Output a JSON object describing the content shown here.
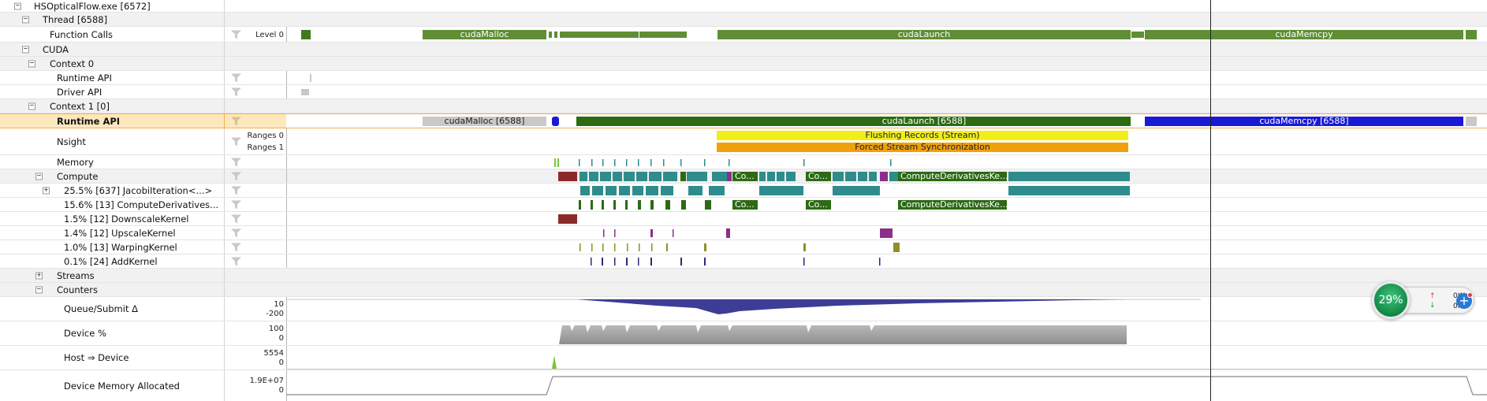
{
  "tree": {
    "process": "HSOpticalFlow.exe [6572]",
    "thread": "Thread [6588]",
    "function_calls": "Function Calls",
    "level_label": "Level 0",
    "cuda": "CUDA",
    "context0": "Context 0",
    "runtime_api_0": "Runtime API",
    "driver_api": "Driver API",
    "context1": "Context 1 [0]",
    "runtime_api_1": "Runtime API",
    "nsight": "Nsight",
    "ranges0": "Ranges 0",
    "ranges1": "Ranges 1",
    "memory": "Memory",
    "compute": "Compute",
    "kernels": [
      "25.5% [637] JacobiIteration<...>",
      "15.6% [13] ComputeDerivatives...",
      "1.5% [12] DownscaleKernel",
      "1.4% [12] UpscaleKernel",
      "1.0% [13] WarpingKernel",
      "0.1% [24] AddKernel"
    ],
    "streams": "Streams",
    "counters": "Counters",
    "counter_rows": [
      {
        "name": "Queue/Submit Δ",
        "max": "10",
        "min": "-200"
      },
      {
        "name": "Device %",
        "max": "100",
        "min": "0"
      },
      {
        "name": "Host ⇒ Device",
        "max": "5554",
        "min": "0"
      },
      {
        "name": "Device Memory Allocated",
        "max": "1.9E+07",
        "min": "0"
      }
    ]
  },
  "timeline": {
    "func_calls": {
      "malloc": "cudaMalloc",
      "launch": "cudaLaunch",
      "memcpy": "cudaMemcpy"
    },
    "runtime_api_1": {
      "malloc": "cudaMalloc [6588]",
      "launch": "cudaLaunch [6588]",
      "memcpy": "cudaMemcpy [6588]"
    },
    "nsight_ranges": [
      "Flushing Records (Stream)",
      "Forced Stream Synchronization"
    ],
    "compute_labels": [
      "Co...",
      "Co...",
      "ComputeDerivativesKe..."
    ],
    "computederiv_labels": [
      "Co...",
      "Co...",
      "ComputeDerivativesKe..."
    ]
  },
  "colors": {
    "call_green": "#3f7a1f",
    "memcpy_blue": "#1a1ad6",
    "flush_yellow": "#f2ee1a",
    "sync_orange": "#f0a00a",
    "jacobi_teal": "#2f8c8c",
    "downscale_red": "#8c2a2a",
    "upscale_purple": "#8a2f8a",
    "warping_olive": "#8f8f2a",
    "add_navy": "#2a2a7a",
    "queue_fill": "#3d3d96",
    "device_fill": "#a8a8a8",
    "selected_row": "#fde7bd"
  },
  "network_widget": {
    "percent": "29%",
    "up": "0K/s",
    "down": "0K/s"
  }
}
